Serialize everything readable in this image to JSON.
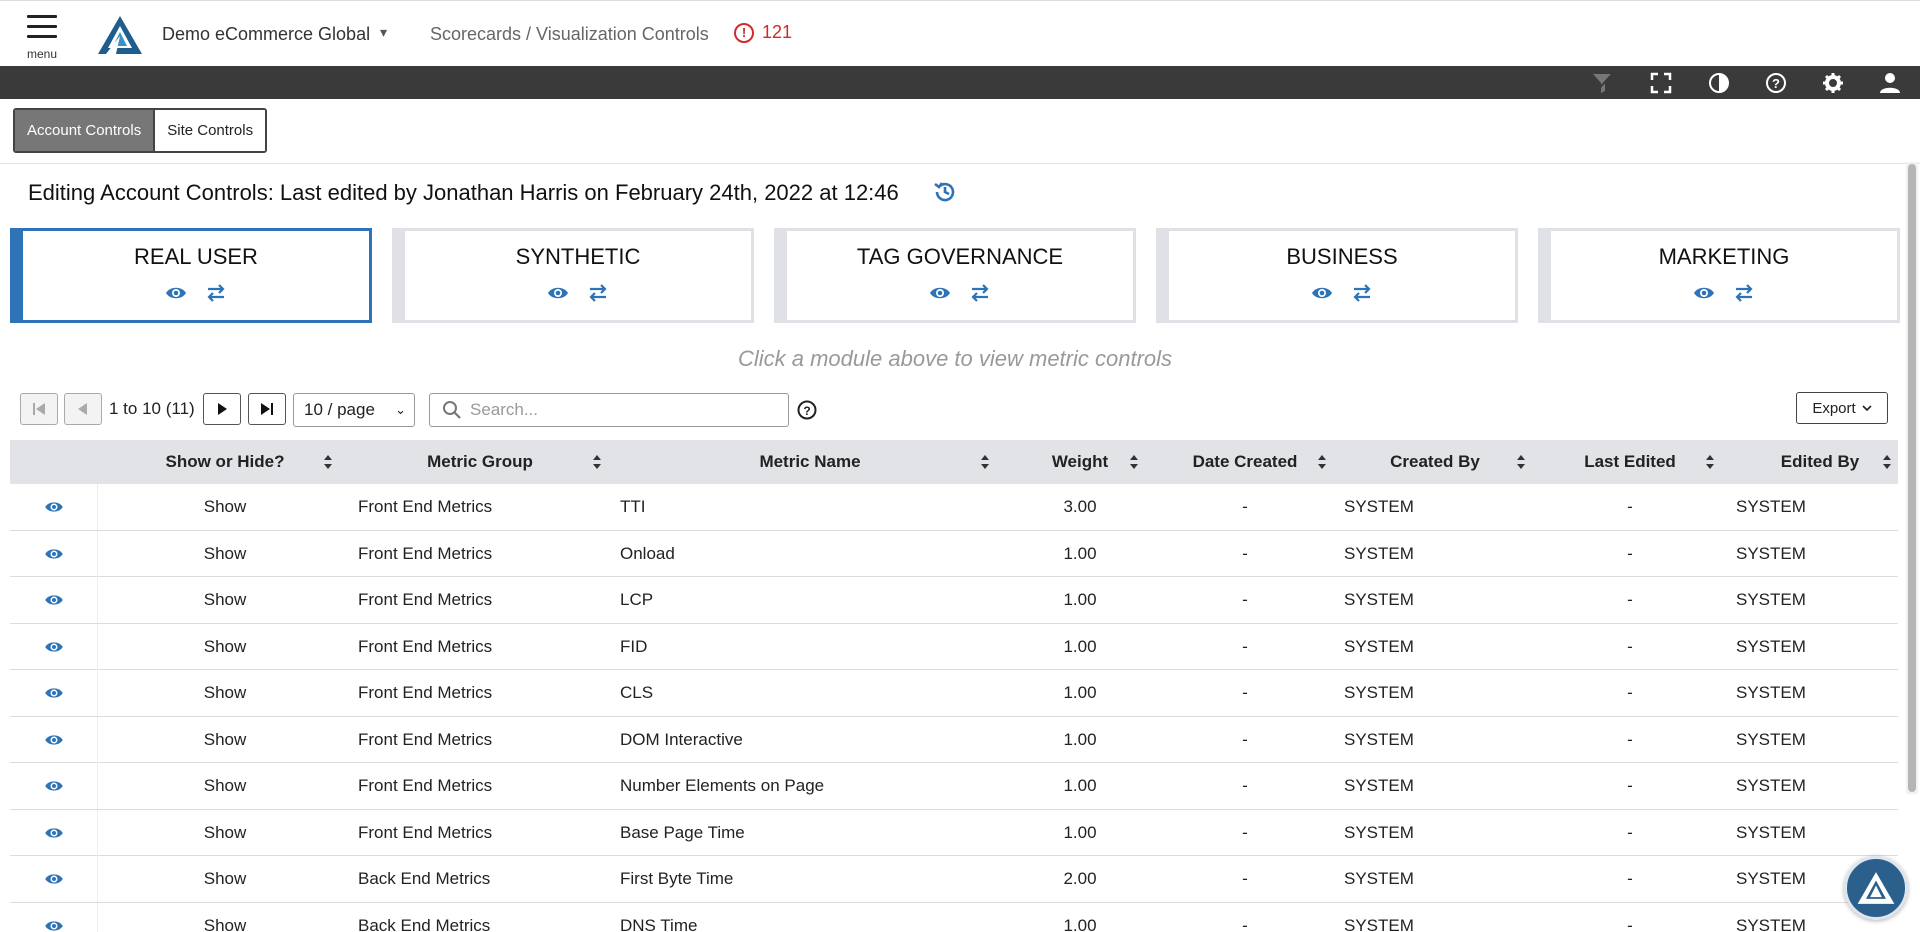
{
  "header": {
    "menu_label": "menu",
    "account_name": "Demo eCommerce Global",
    "breadcrumb": "Scorecards / Visualization Controls",
    "alert_count": "121"
  },
  "toolbar": {
    "icons": [
      "filter-icon",
      "fullscreen-icon",
      "contrast-icon",
      "help-icon",
      "settings-icon",
      "user-icon"
    ]
  },
  "controls_tabs": [
    {
      "label": "Account Controls",
      "active": true
    },
    {
      "label": "Site Controls",
      "active": false
    }
  ],
  "editing_title": "Editing Account Controls: Last edited by Jonathan Harris on February 24th, 2022 at 12:46",
  "modules": [
    {
      "title": "REAL USER",
      "selected": true
    },
    {
      "title": "SYNTHETIC",
      "selected": false
    },
    {
      "title": "TAG GOVERNANCE",
      "selected": false
    },
    {
      "title": "BUSINESS",
      "selected": false
    },
    {
      "title": "MARKETING",
      "selected": false
    }
  ],
  "hint": "Click a module above to view metric controls",
  "pagination": {
    "range_text": "1 to 10 (11)",
    "page_size": "10 / page"
  },
  "search": {
    "placeholder": "Search..."
  },
  "export_label": "Export",
  "table": {
    "columns": [
      "Show or Hide?",
      "Metric Group",
      "Metric Name",
      "Weight",
      "Date Created",
      "Created By",
      "Last Edited",
      "Edited By"
    ],
    "rows": [
      {
        "show": "Show",
        "group": "Front End Metrics",
        "name": "TTI",
        "weight": "3.00",
        "date_created": "-",
        "created_by": "SYSTEM",
        "last_edited": "-",
        "edited_by": "SYSTEM"
      },
      {
        "show": "Show",
        "group": "Front End Metrics",
        "name": "Onload",
        "weight": "1.00",
        "date_created": "-",
        "created_by": "SYSTEM",
        "last_edited": "-",
        "edited_by": "SYSTEM"
      },
      {
        "show": "Show",
        "group": "Front End Metrics",
        "name": "LCP",
        "weight": "1.00",
        "date_created": "-",
        "created_by": "SYSTEM",
        "last_edited": "-",
        "edited_by": "SYSTEM"
      },
      {
        "show": "Show",
        "group": "Front End Metrics",
        "name": "FID",
        "weight": "1.00",
        "date_created": "-",
        "created_by": "SYSTEM",
        "last_edited": "-",
        "edited_by": "SYSTEM"
      },
      {
        "show": "Show",
        "group": "Front End Metrics",
        "name": "CLS",
        "weight": "1.00",
        "date_created": "-",
        "created_by": "SYSTEM",
        "last_edited": "-",
        "edited_by": "SYSTEM"
      },
      {
        "show": "Show",
        "group": "Front End Metrics",
        "name": "DOM Interactive",
        "weight": "1.00",
        "date_created": "-",
        "created_by": "SYSTEM",
        "last_edited": "-",
        "edited_by": "SYSTEM"
      },
      {
        "show": "Show",
        "group": "Front End Metrics",
        "name": "Number Elements on Page",
        "weight": "1.00",
        "date_created": "-",
        "created_by": "SYSTEM",
        "last_edited": "-",
        "edited_by": "SYSTEM"
      },
      {
        "show": "Show",
        "group": "Front End Metrics",
        "name": "Base Page Time",
        "weight": "1.00",
        "date_created": "-",
        "created_by": "SYSTEM",
        "last_edited": "-",
        "edited_by": "SYSTEM"
      },
      {
        "show": "Show",
        "group": "Back End Metrics",
        "name": "First Byte Time",
        "weight": "2.00",
        "date_created": "-",
        "created_by": "SYSTEM",
        "last_edited": "-",
        "edited_by": "SYSTEM"
      },
      {
        "show": "Show",
        "group": "Back End Metrics",
        "name": "DNS Time",
        "weight": "1.00",
        "date_created": "-",
        "created_by": "SYSTEM",
        "last_edited": "-",
        "edited_by": "SYSTEM"
      }
    ]
  },
  "colors": {
    "accent": "#2e73b8",
    "alert": "#d12a2a",
    "toolbar_bg": "#3a3a3a",
    "table_header_bg": "#e1e3e7"
  }
}
